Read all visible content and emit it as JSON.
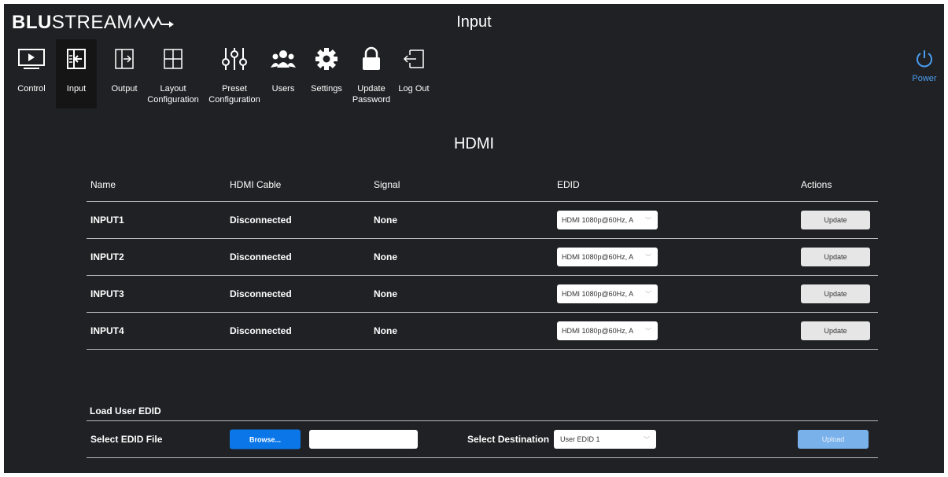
{
  "logo": {
    "bold": "BLU",
    "light": "STREAM"
  },
  "page_title": "Input",
  "nav": [
    {
      "label": "Control",
      "icon": "play-icon"
    },
    {
      "label": "Input",
      "icon": "input-icon"
    },
    {
      "label": "Output",
      "icon": "output-icon"
    },
    {
      "label": "Layout Configuration",
      "icon": "layout-grid-icon"
    },
    {
      "label": "Preset Configuration",
      "icon": "sliders-icon"
    },
    {
      "label": "Users",
      "icon": "users-icon"
    },
    {
      "label": "Settings",
      "icon": "gear-icon"
    },
    {
      "label": "Update Password",
      "icon": "lock-icon"
    },
    {
      "label": "Log Out",
      "icon": "logout-icon"
    }
  ],
  "power": {
    "label": "Power",
    "color": "#4a9df0"
  },
  "section_title": "HDMI",
  "table": {
    "headers": [
      "Name",
      "HDMI Cable",
      "Signal",
      "EDID",
      "Actions"
    ],
    "rows": [
      {
        "name": "INPUT1",
        "cable": "Disconnected",
        "signal": "None",
        "edid": "HDMI 1080p@60Hz, A",
        "action": "Update"
      },
      {
        "name": "INPUT2",
        "cable": "Disconnected",
        "signal": "None",
        "edid": "HDMI 1080p@60Hz, A",
        "action": "Update"
      },
      {
        "name": "INPUT3",
        "cable": "Disconnected",
        "signal": "None",
        "edid": "HDMI 1080p@60Hz, A",
        "action": "Update"
      },
      {
        "name": "INPUT4",
        "cable": "Disconnected",
        "signal": "None",
        "edid": "HDMI 1080p@60Hz, A",
        "action": "Update"
      }
    ]
  },
  "load_edid": {
    "title": "Load User EDID",
    "select_file_label": "Select EDID File",
    "browse_label": "Browse...",
    "file_value": "",
    "destination_label": "Select Destination",
    "destination_value": "User EDID 1",
    "upload_label": "Upload"
  },
  "colors": {
    "background": "#202124",
    "accent_blue": "#0a76e8",
    "upload_blue": "#79b1ea"
  }
}
